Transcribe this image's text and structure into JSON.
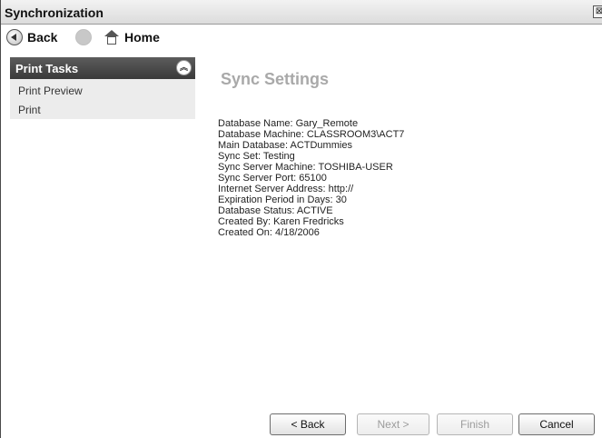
{
  "window": {
    "title": "Synchronization",
    "close_glyph": "⊠"
  },
  "nav": {
    "back_label": "Back",
    "home_label": "Home"
  },
  "sidebar": {
    "title": "Print Tasks",
    "collapse_glyph": "︽",
    "items": [
      {
        "label": "Print Preview"
      },
      {
        "label": "Print"
      }
    ]
  },
  "content": {
    "heading": "Sync Settings",
    "details": [
      "Database Name: Gary_Remote",
      "Database Machine: CLASSROOM3\\ACT7",
      "Main Database: ACTDummies",
      "Sync Set: Testing",
      "Sync Server Machine: TOSHIBA-USER",
      "Sync Server Port: 65100",
      "Internet Server Address: http://",
      "Expiration Period in Days: 30",
      "Database Status: ACTIVE",
      "Created By: Karen Fredricks",
      "Created On: 4/18/2006"
    ]
  },
  "buttons": {
    "back": "< Back",
    "next": "Next >",
    "finish": "Finish",
    "cancel": "Cancel"
  },
  "icons": {
    "back": "back-arrow-circle-icon",
    "forward": "forward-circle-icon",
    "home": "home-icon",
    "collapse": "collapse-chevron-icon",
    "close": "close-icon"
  },
  "colors": {
    "sidebar_header": "#4a4a4a",
    "sidebar_bg": "#ececec",
    "heading": "#a9a9a9"
  }
}
